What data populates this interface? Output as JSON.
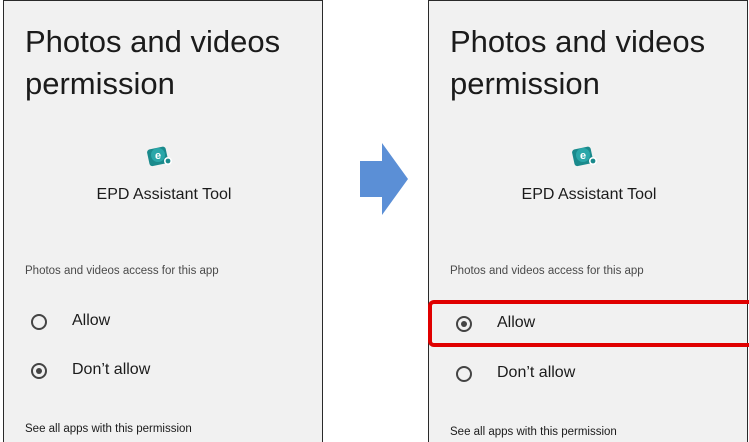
{
  "before": {
    "title": "Photos and videos permission",
    "app_icon": "app-icon",
    "app_name": "EPD Assistant Tool",
    "section_label": "Photos and videos access for this app",
    "options": [
      {
        "label": "Allow",
        "checked": false
      },
      {
        "label": "Don’t allow",
        "checked": true
      }
    ],
    "footer_link": "See all apps with this permission"
  },
  "after": {
    "title": "Photos and videos permission",
    "app_icon": "app-icon",
    "app_name": "EPD Assistant Tool",
    "section_label": "Photos and videos access for this app",
    "options": [
      {
        "label": "Allow",
        "checked": true
      },
      {
        "label": "Don’t allow",
        "checked": false
      }
    ],
    "footer_link": "See all apps with this permission"
  },
  "arrow_icon": "right-arrow-icon",
  "colors": {
    "arrow": "#5b8fd6",
    "highlight": "#e00000",
    "panel_bg": "#f1f1f1",
    "icon_primary": "#1a8a8c",
    "icon_accent": "#ffffff"
  }
}
